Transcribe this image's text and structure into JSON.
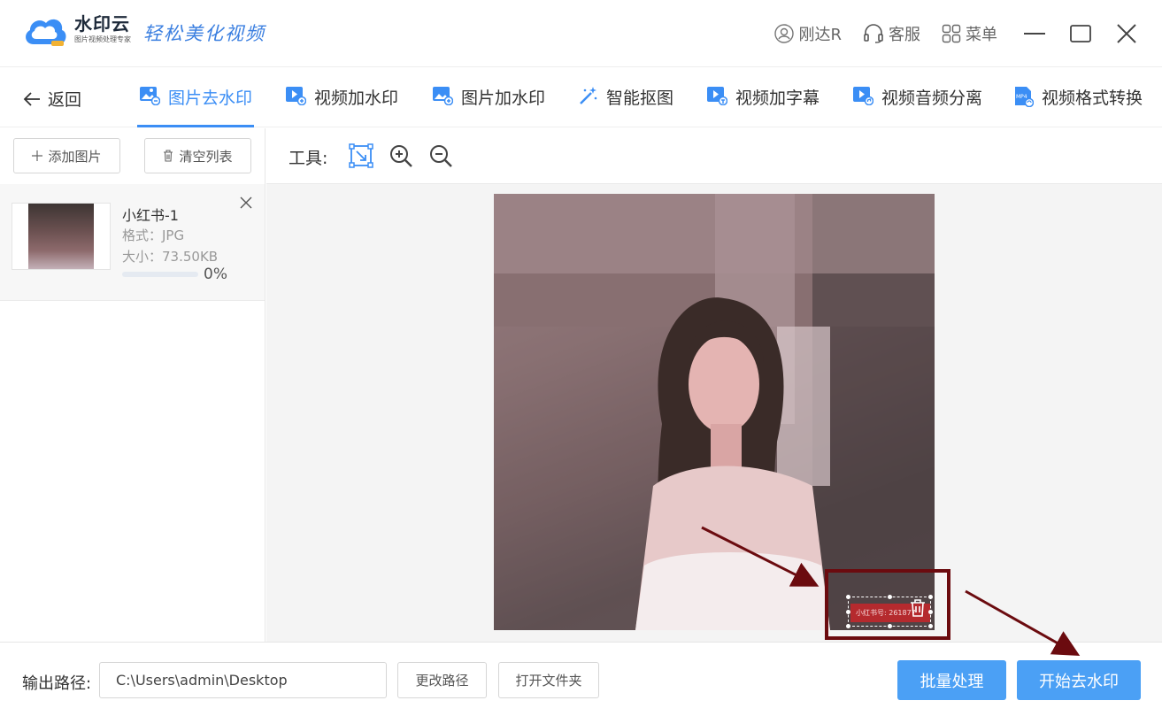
{
  "app": {
    "name": "水印云",
    "sub": "图片视频处理专家",
    "slogan": "轻松美化视频"
  },
  "header": {
    "user": "刚达R",
    "service": "客服",
    "menu": "菜单"
  },
  "nav": {
    "back": "返回",
    "tabs": [
      {
        "label": "图片去水印",
        "icon": "image-remove-icon",
        "active": true
      },
      {
        "label": "视频加水印",
        "icon": "video-add-icon",
        "active": false
      },
      {
        "label": "图片加水印",
        "icon": "image-add-icon",
        "active": false
      },
      {
        "label": "智能抠图",
        "icon": "magic-wand-icon",
        "active": false
      },
      {
        "label": "视频加字幕",
        "icon": "video-subtitle-icon",
        "active": false
      },
      {
        "label": "视频音频分离",
        "icon": "video-audio-icon",
        "active": false
      },
      {
        "label": "视频格式转换",
        "icon": "mp4-convert-icon",
        "active": false
      }
    ]
  },
  "sidebar": {
    "add_button": "添加图片",
    "clear_button": "清空列表",
    "files": [
      {
        "name": "小红书-1",
        "format": "格式：JPG",
        "size": "大小：73.50KB",
        "progress_percent": 0,
        "progress_text": "0%"
      }
    ]
  },
  "toolbar": {
    "label": "工具:",
    "tools": [
      "select-region-icon",
      "zoom-in-icon",
      "zoom-out-icon"
    ]
  },
  "preview": {
    "watermark_text": "小红书号: 261877"
  },
  "footer": {
    "output_label": "输出路径:",
    "output_path": "C:\\Users\\admin\\Desktop",
    "change_path": "更改路径",
    "open_folder": "打开文件夹",
    "batch": "批量处理",
    "start": "开始去水印"
  },
  "colors": {
    "accent": "#3b8ef5",
    "primary_button": "#4ba0f5",
    "annotation": "#6b0b0f"
  }
}
